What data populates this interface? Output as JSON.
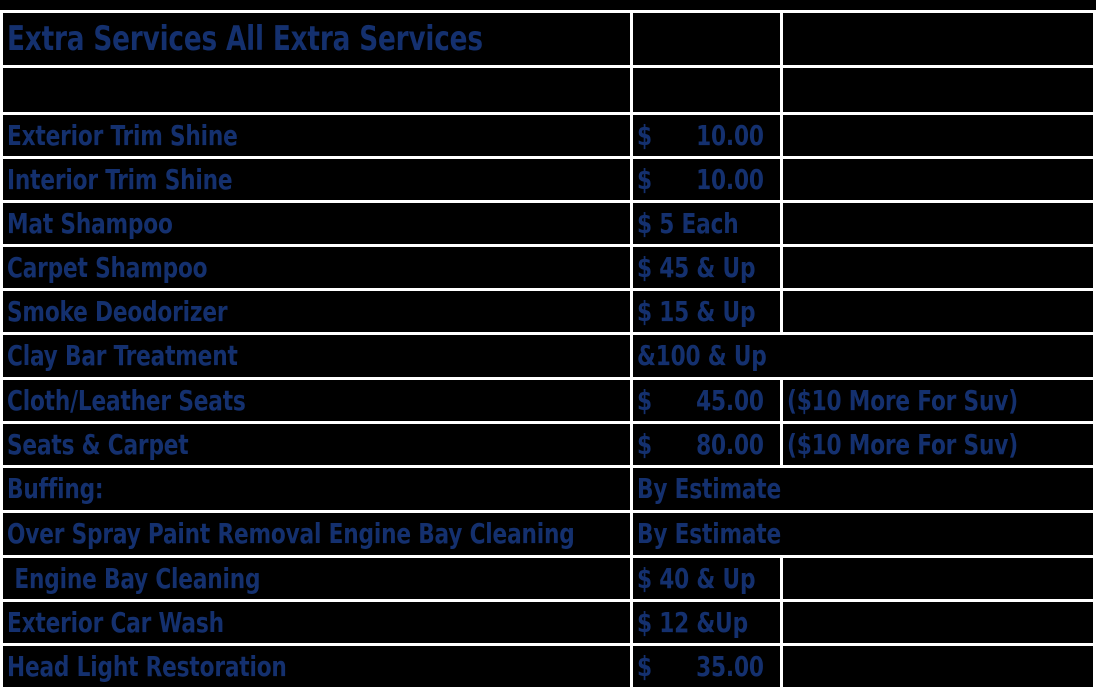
{
  "document": {
    "title": "Extra Services All Extra Services",
    "text_color": "#14306e",
    "background_color": "#000000",
    "grid_color": "#ffffff"
  },
  "table": {
    "columns": [
      {
        "key": "service",
        "header": ""
      },
      {
        "key": "price",
        "header": ""
      },
      {
        "key": "note",
        "header": ""
      }
    ],
    "rows": [
      {
        "type": "title",
        "service": "Extra Services All Extra Services",
        "price": "",
        "note": ""
      },
      {
        "type": "blank",
        "service": "",
        "price": "",
        "note": ""
      },
      {
        "type": "data",
        "service": "Exterior Trim Shine",
        "price": "$      10.00",
        "note": ""
      },
      {
        "type": "data",
        "service": "Interior Trim Shine",
        "price": "$      10.00",
        "note": ""
      },
      {
        "type": "data",
        "service": "Mat Shampoo",
        "price": "$ 5 Each",
        "note": ""
      },
      {
        "type": "data",
        "service": "Carpet Shampoo",
        "price": "$ 45 & Up",
        "note": ""
      },
      {
        "type": "data",
        "service": "Smoke Deodorizer",
        "price": "$ 15 & Up",
        "note": ""
      },
      {
        "type": "span",
        "service": "Clay Bar Treatment",
        "price": "&100 & Up",
        "note": ""
      },
      {
        "type": "data",
        "service": "Cloth/Leather Seats",
        "price": "$      45.00",
        "note": "($10 More For Suv)"
      },
      {
        "type": "data",
        "service": "Seats & Carpet",
        "price": "$      80.00",
        "note": "($10 More For Suv)"
      },
      {
        "type": "span",
        "service": "Buffing:",
        "price": "By Estimate",
        "note": ""
      },
      {
        "type": "span",
        "service": "Over Spray Paint Removal Engine Bay Cleaning",
        "price": "By Estimate",
        "note": ""
      },
      {
        "type": "data",
        "service": " Engine Bay Cleaning",
        "price": "$ 40 & Up",
        "note": ""
      },
      {
        "type": "data",
        "service": "Exterior Car Wash",
        "price": "$ 12 &Up",
        "note": ""
      },
      {
        "type": "data",
        "service": "Head Light Restoration",
        "price": "$      35.00",
        "note": ""
      }
    ]
  }
}
